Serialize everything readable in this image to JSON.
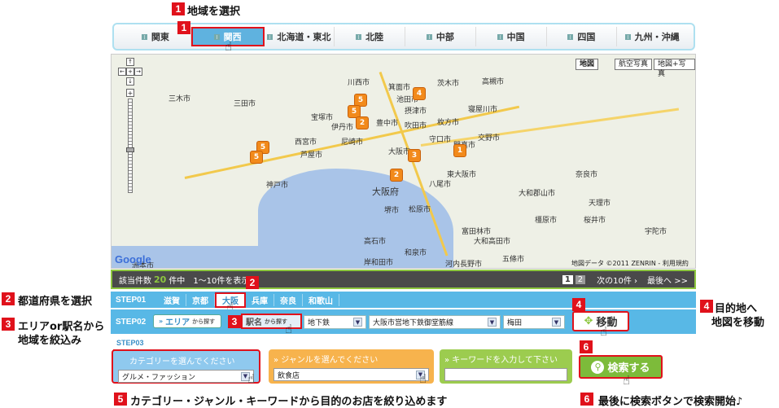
{
  "callouts": {
    "c1": {
      "num": "1",
      "text": "地域を選択"
    },
    "c2": {
      "num": "2",
      "text": "都道府県を選択"
    },
    "c3": {
      "num": "3",
      "text": "エリアor駅名から",
      "text2": "地域を絞込み"
    },
    "c4": {
      "num": "4",
      "text": "目的地へ",
      "text2": "地図を移動"
    },
    "c5": {
      "num": "5",
      "text": "カテゴリー・ジャンル・キーワードから目的のお店を絞り込めます"
    },
    "c6": {
      "num": "6",
      "text": "最後に検索ボタンで検索開始♪"
    }
  },
  "regions": [
    "関東",
    "関西",
    "北海道・東北",
    "北陸",
    "中部",
    "中国",
    "四国",
    "九州・沖縄"
  ],
  "active_region": "関西",
  "map": {
    "type_buttons": [
      "地図",
      "航空写真",
      "地図+写真"
    ],
    "cities": [
      "川西市",
      "箕面市",
      "茨木市",
      "高槻市",
      "三木市",
      "三田市",
      "池田市",
      "摂津市",
      "寝屋川市",
      "宝塚市",
      "伊丹市",
      "豊中市",
      "吹田市",
      "枚方市",
      "交野市",
      "西宮市",
      "尼崎市",
      "守口市",
      "門真市",
      "芦屋市",
      "大阪市",
      "東大阪市",
      "八尾市",
      "奈良市",
      "神戸市",
      "大阪府",
      "堺市",
      "松原市",
      "大和郡山市",
      "天理市",
      "高石市",
      "富田林市",
      "和泉市",
      "岸和田市",
      "河内長野市",
      "宇陀市",
      "桜井市",
      "橿原市",
      "大和高田市",
      "洲本市",
      "五條市"
    ],
    "markers": [
      "5",
      "4",
      "5",
      "2",
      "5",
      "3",
      "1",
      "5",
      "2"
    ],
    "copyright": "地図データ ©2011 ZENRIN - 利用規約",
    "logo": "Google"
  },
  "results": {
    "prefix": "該当件数",
    "count": "20",
    "suffix": "件中",
    "range": "1〜10件を表示",
    "pages": [
      "1",
      "2"
    ],
    "next": "次の10件 ›",
    "last": "最後へ >>"
  },
  "step01": {
    "label": "STEP01",
    "prefs": [
      "滋賀",
      "京都",
      "大阪",
      "兵庫",
      "奈良",
      "和歌山"
    ],
    "selected": "大阪"
  },
  "step02": {
    "label": "STEP02",
    "area_button": "エリア",
    "area_suffix": "から探す",
    "station_button": "駅名",
    "station_suffix": "から探す",
    "line_type": "地下鉄",
    "line": "大阪市営地下鉄御堂筋線",
    "station": "梅田",
    "move_button": "移動"
  },
  "step03": {
    "label": "STEP03",
    "category": {
      "header": "カテゴリーを選んでください",
      "value": "グルメ・ファッション"
    },
    "genre": {
      "header": "ジャンルを選んでください",
      "value": "飲食店"
    },
    "keyword": {
      "header": "キーワードを入力して下さい",
      "value": ""
    },
    "search_button": "検索する"
  }
}
